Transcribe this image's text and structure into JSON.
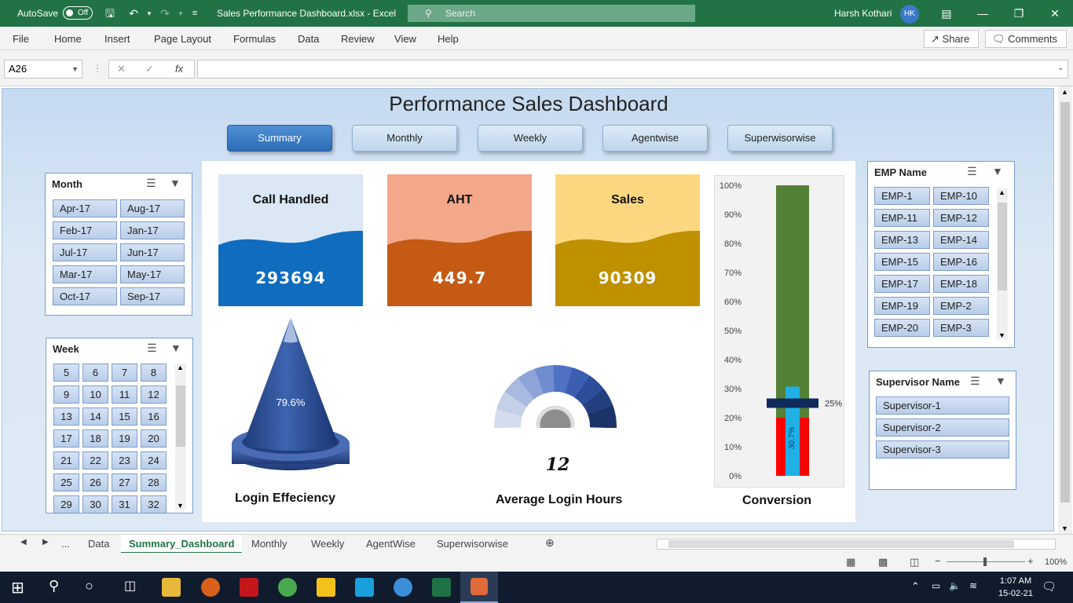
{
  "titlebar": {
    "autosave_label": "AutoSave",
    "autosave_state": "Off",
    "doc_title": "Sales Performance Dashboard.xlsx  -  Excel",
    "search_placeholder": "Search",
    "user_name": "Harsh Kothari",
    "user_initials": "HK"
  },
  "ribbon": {
    "tabs": [
      "File",
      "Home",
      "Insert",
      "Page Layout",
      "Formulas",
      "Data",
      "Review",
      "View",
      "Help"
    ],
    "share": "Share",
    "comments": "Comments"
  },
  "formula_bar": {
    "cell_ref": "A26",
    "value": ""
  },
  "dashboard": {
    "title": "Performance Sales Dashboard",
    "nav": [
      "Summary",
      "Monthly",
      "Weekly",
      "Agentwise",
      "Superwisorwise"
    ],
    "active_nav": "Summary",
    "kpis": [
      {
        "title": "Call Handled",
        "value": "293694",
        "light": "#dce7f5",
        "dark": "#0f6cbf"
      },
      {
        "title": "AHT",
        "value": "449.7",
        "light": "#f3a88a",
        "dark": "#c55a15"
      },
      {
        "title": "Sales",
        "value": "90309",
        "light": "#fdd77f",
        "dark": "#bf9000"
      }
    ],
    "login_efficiency": {
      "label": "79.6%",
      "caption": "Login Effeciency"
    },
    "avg_login_hours": {
      "value": "12",
      "caption": "Average Login Hours"
    },
    "conversion": {
      "caption": "Conversion",
      "axis_labels": [
        "100%",
        "90%",
        "80%",
        "70%",
        "60%",
        "50%",
        "40%",
        "30%",
        "20%",
        "10%",
        "0%"
      ],
      "target_label": "25%",
      "actual_label": "30.7%",
      "actual": 0.307,
      "target": 0.25,
      "green_max": 1.0,
      "red_max": 0.2
    }
  },
  "slicers": {
    "month": {
      "title": "Month",
      "items": [
        "Apr-17",
        "Aug-17",
        "Feb-17",
        "Jan-17",
        "Jul-17",
        "Jun-17",
        "Mar-17",
        "May-17",
        "Oct-17",
        "Sep-17"
      ]
    },
    "week": {
      "title": "Week",
      "items": [
        "5",
        "6",
        "7",
        "8",
        "9",
        "10",
        "11",
        "12",
        "13",
        "14",
        "15",
        "16",
        "17",
        "18",
        "19",
        "20",
        "21",
        "22",
        "23",
        "24",
        "25",
        "26",
        "27",
        "28",
        "29",
        "30",
        "31",
        "32"
      ]
    },
    "emp": {
      "title": "EMP Name",
      "items": [
        "EMP-1",
        "EMP-10",
        "EMP-11",
        "EMP-12",
        "EMP-13",
        "EMP-14",
        "EMP-15",
        "EMP-16",
        "EMP-17",
        "EMP-18",
        "EMP-19",
        "EMP-2",
        "EMP-20",
        "EMP-3"
      ]
    },
    "supervisor": {
      "title": "Supervisor Name",
      "items": [
        "Supervisor-1",
        "Supervisor-2",
        "Supervisor-3"
      ]
    }
  },
  "sheet_tabs": [
    "Data",
    "Summary_Dashboard",
    "Monthly",
    "Weekly",
    "AgentWise",
    "Superwisorwise"
  ],
  "active_sheet": "Summary_Dashboard",
  "status": {
    "zoom": "100%"
  },
  "taskbar": {
    "time": "1:07 AM",
    "date": "15-02-21"
  }
}
